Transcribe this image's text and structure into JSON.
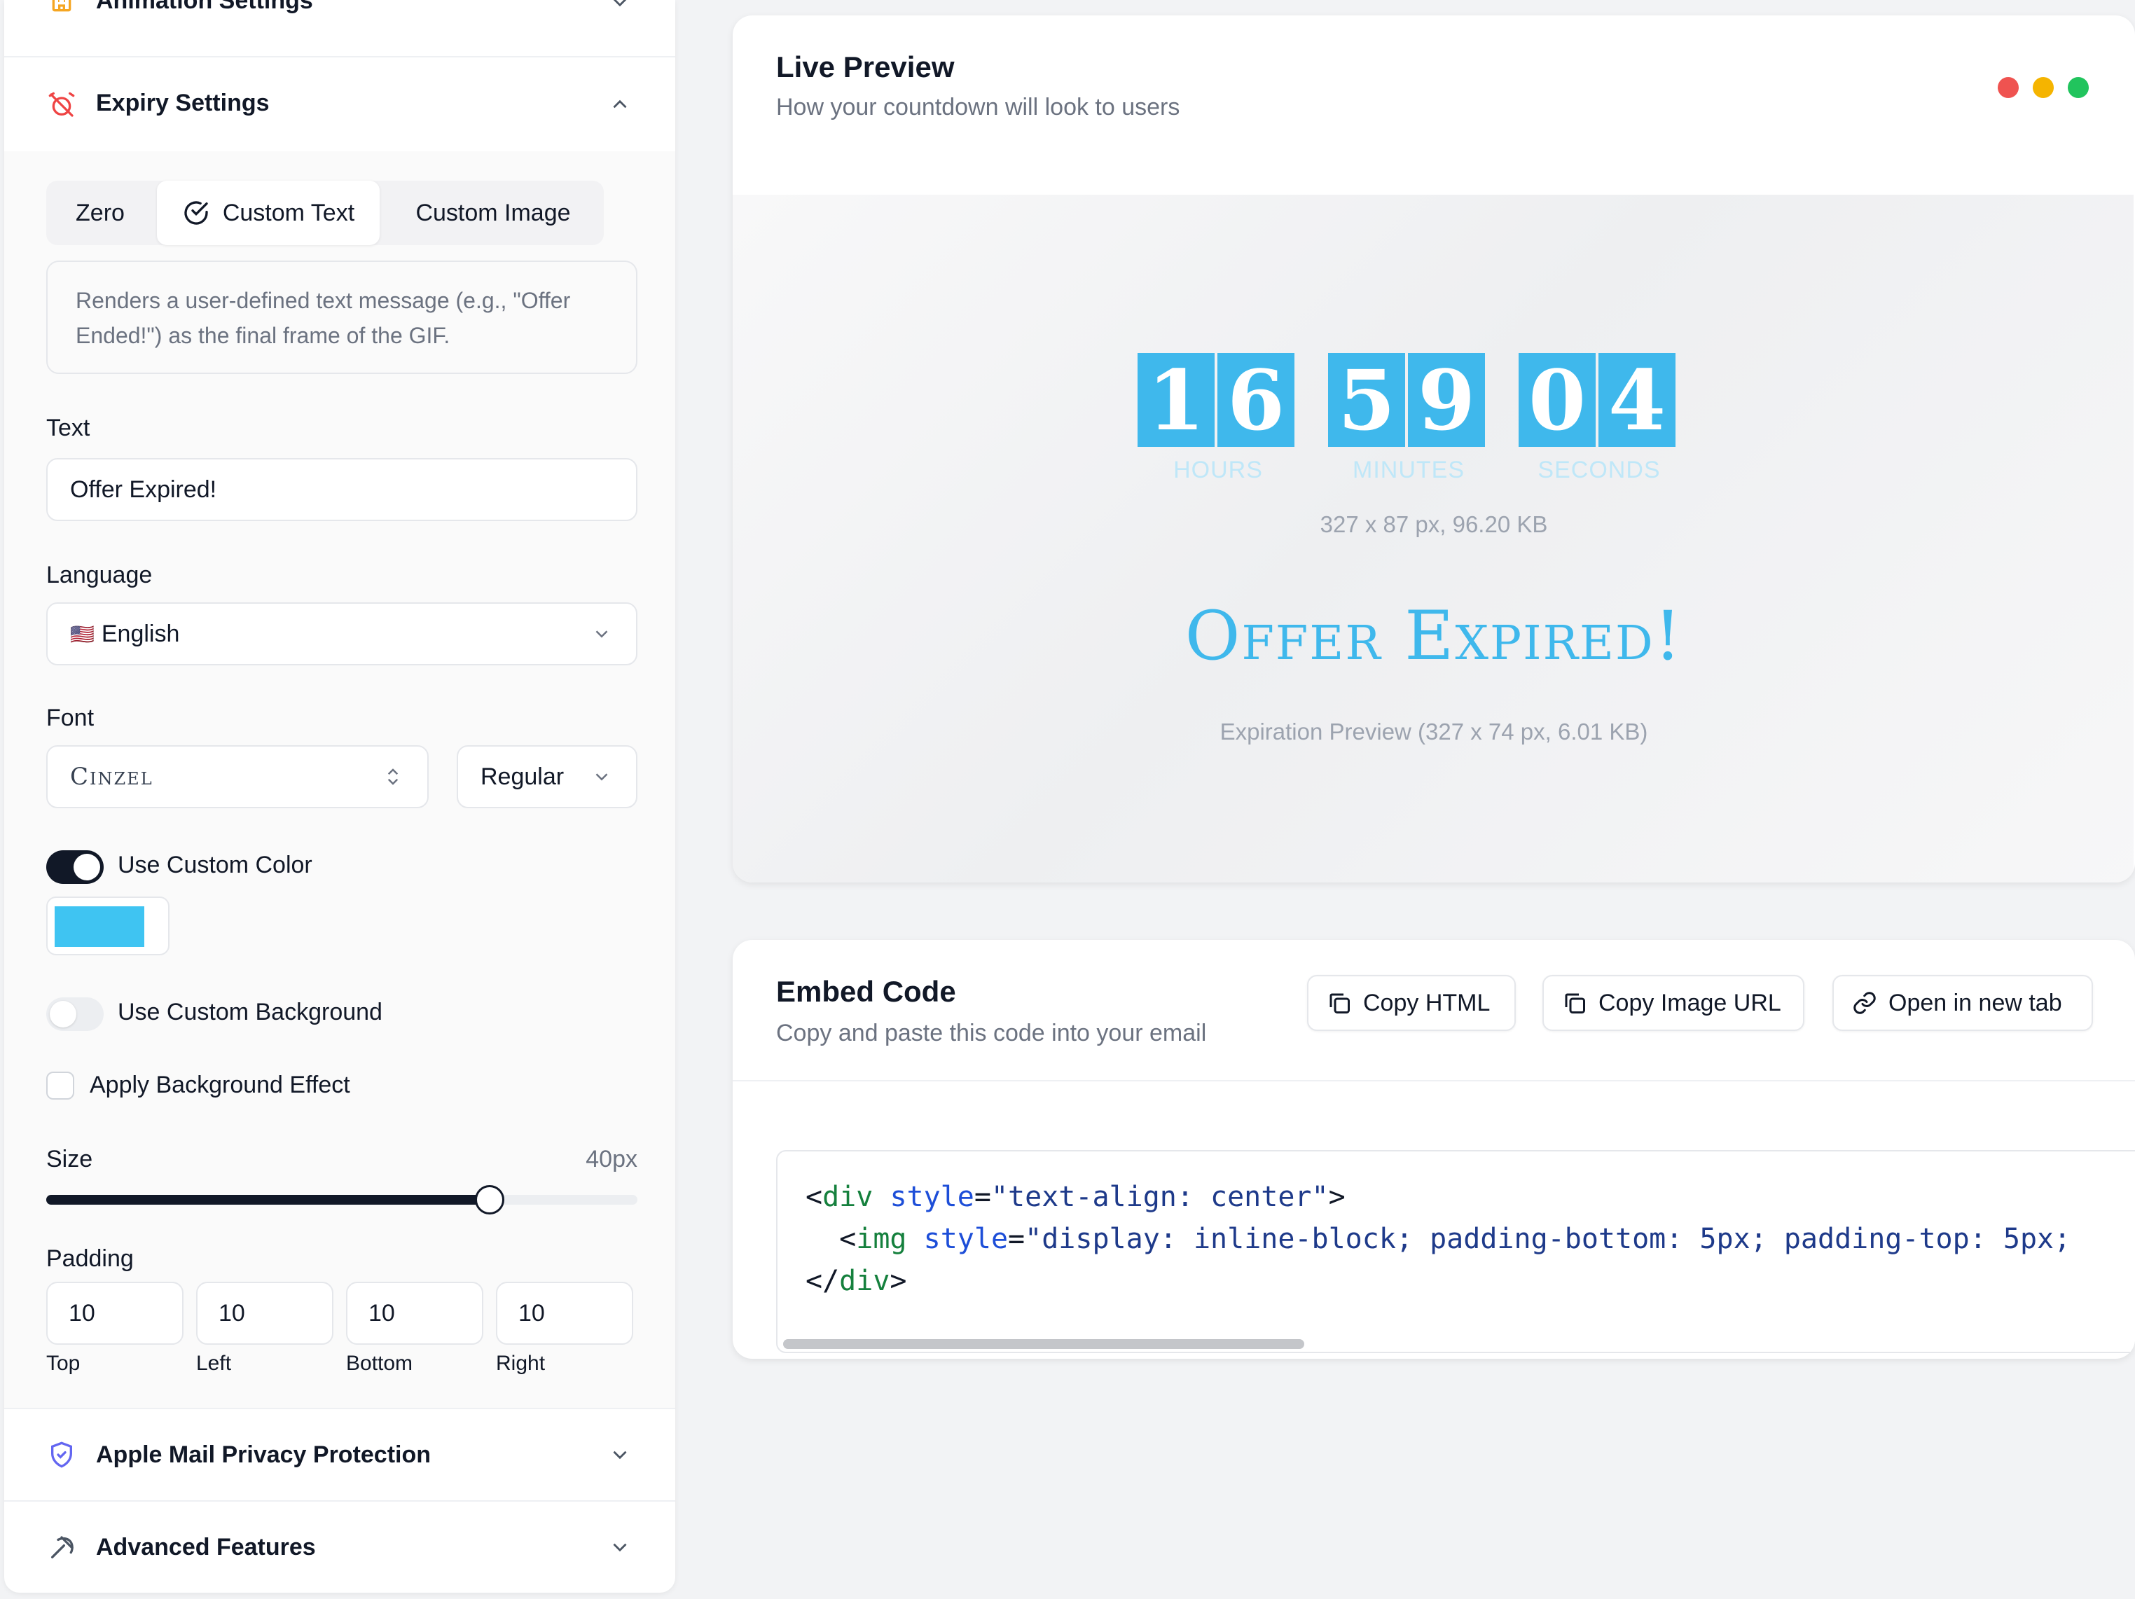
{
  "left_panel": {
    "animation_settings": {
      "title": "Animation Settings",
      "icon": "building-icon"
    },
    "expiry_settings": {
      "title": "Expiry Settings",
      "icon": "alarm-off-icon",
      "modes": [
        "Zero",
        "Custom Text",
        "Custom Image"
      ],
      "selected_mode": "Custom Text",
      "description": "Renders a user-defined text message (e.g., \"Offer Ended!\") as the final frame of the GIF.",
      "text_label": "Text",
      "text_value": "Offer Expired!",
      "language_label": "Language",
      "language_flag": "🇺🇸",
      "language_value": "English",
      "font_label": "Font",
      "font_value": "Cinzel",
      "font_weight_value": "Regular",
      "use_custom_color_label": "Use Custom Color",
      "use_custom_color_on": true,
      "custom_color": "#3fc4f2",
      "use_custom_background_label": "Use Custom Background",
      "use_custom_background_on": false,
      "apply_background_effect_label": "Apply Background Effect",
      "apply_background_effect_checked": false,
      "size_label": "Size",
      "size_value": "40px",
      "size_slider_fraction": 0.75,
      "padding_label": "Padding",
      "padding": {
        "top": "10",
        "left": "10",
        "bottom": "10",
        "right": "10"
      },
      "padding_labels": {
        "top": "Top",
        "left": "Left",
        "bottom": "Bottom",
        "right": "Right"
      }
    },
    "apple_mail": {
      "title": "Apple Mail Privacy Protection",
      "icon": "shield-check-icon"
    },
    "advanced": {
      "title": "Advanced Features",
      "icon": "pickaxe-icon"
    }
  },
  "live_preview": {
    "title": "Live Preview",
    "subtitle": "How your countdown will look to users",
    "window_dots": [
      "#ef5350",
      "#f5b400",
      "#21c45d"
    ],
    "countdown": {
      "hours": [
        "1",
        "6"
      ],
      "minutes": [
        "5",
        "9"
      ],
      "seconds": [
        "0",
        "4"
      ],
      "labels": {
        "hours": "HOURS",
        "minutes": "MINUTES",
        "seconds": "SECONDS"
      }
    },
    "countdown_meta": "327 x 87 px, 96.20 KB",
    "expired_text": "Offer Expired!",
    "expiration_meta": "Expiration Preview (327 x 74 px, 6.01 KB)",
    "digit_color": "#3fb8ec"
  },
  "embed_code": {
    "title": "Embed Code",
    "subtitle": "Copy and paste this code into your email",
    "buttons": {
      "copy_html": "Copy HTML",
      "copy_image_url": "Copy Image URL",
      "open_new_tab": "Open in new tab"
    },
    "code": {
      "line1": {
        "open": "<",
        "tag": "div",
        "attr": "style",
        "eq": "=",
        "val": "\"text-align: center\"",
        "close": ">"
      },
      "line2": {
        "open": "<",
        "tag": "img",
        "attr": "style",
        "eq": "=",
        "val": "\"display: inline-block; padding-bottom: 5px; padding-top: 5px;"
      },
      "line3": {
        "open": "</",
        "tag": "div",
        "close": ">"
      }
    }
  }
}
